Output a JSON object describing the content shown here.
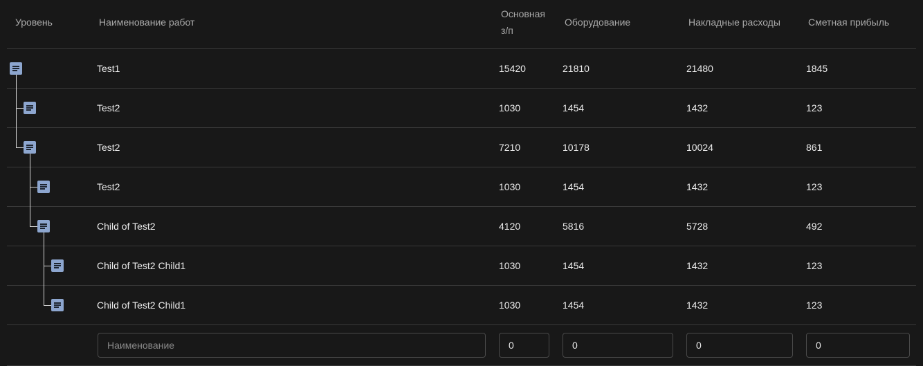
{
  "header": {
    "level": "Уровень",
    "name": "Наименование работ",
    "salary_line1": "Основная",
    "salary_line2": "з/п",
    "equipment": "Оборудование",
    "overhead": "Накладные расходы",
    "profit": "Сметная прибыль"
  },
  "rows": [
    {
      "name": "Test1",
      "salary": "15420",
      "equipment": "21810",
      "overhead": "21480",
      "profit": "1845",
      "depth": 0
    },
    {
      "name": "Test2",
      "salary": "1030",
      "equipment": "1454",
      "overhead": "1432",
      "profit": "123",
      "depth": 1
    },
    {
      "name": "Test2",
      "salary": "7210",
      "equipment": "10178",
      "overhead": "10024",
      "profit": "861",
      "depth": 1
    },
    {
      "name": "Test2",
      "salary": "1030",
      "equipment": "1454",
      "overhead": "1432",
      "profit": "123",
      "depth": 2
    },
    {
      "name": "Child of Test2",
      "salary": "4120",
      "equipment": "5816",
      "overhead": "5728",
      "profit": "492",
      "depth": 2
    },
    {
      "name": "Child of Test2 Child1",
      "salary": "1030",
      "equipment": "1454",
      "overhead": "1432",
      "profit": "123",
      "depth": 3
    },
    {
      "name": "Child of Test2 Child1",
      "salary": "1030",
      "equipment": "1454",
      "overhead": "1432",
      "profit": "123",
      "depth": 3
    }
  ],
  "new_row": {
    "name_placeholder": "Наименование",
    "name_value": "",
    "salary_value": "0",
    "equipment_value": "0",
    "overhead_value": "0",
    "profit_value": "0"
  },
  "icons": {
    "row_icon": "document-icon"
  },
  "colors": {
    "background": "#181818",
    "icon": "#8da6cf",
    "border": "#3a3a3a"
  }
}
